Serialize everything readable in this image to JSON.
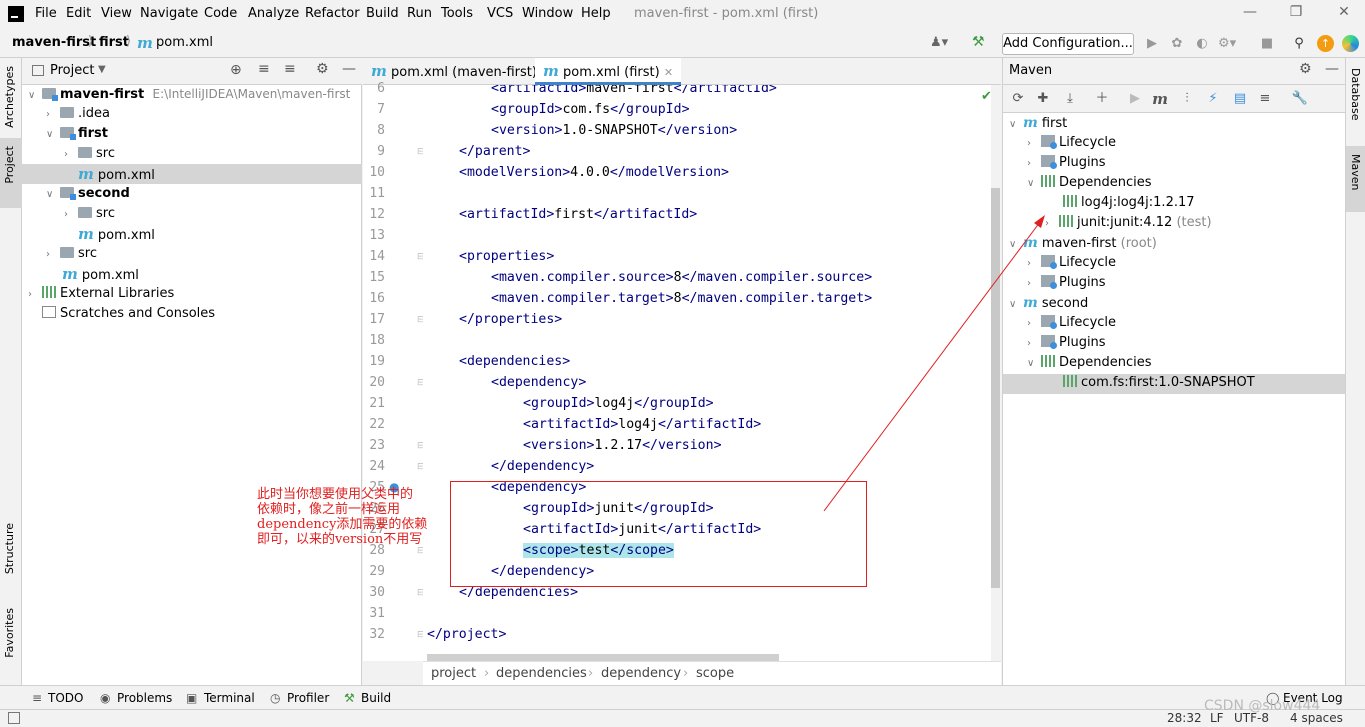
{
  "menubar": {
    "items": [
      "File",
      "Edit",
      "View",
      "Navigate",
      "Code",
      "Analyze",
      "Refactor",
      "Build",
      "Run",
      "Tools",
      "VCS",
      "Window",
      "Help"
    ],
    "title": "maven-first - pom.xml (first)"
  },
  "navbar": {
    "crumbs": [
      "maven-first",
      "first",
      "pom.xml"
    ],
    "add_config": "Add Configuration..."
  },
  "left_strip": {
    "archetypes": "Archetypes",
    "project": "Project",
    "structure": "Structure",
    "favorites": "Favorites"
  },
  "right_strip": {
    "database": "Database",
    "maven": "Maven"
  },
  "project_panel": {
    "title": "Project",
    "rows": [
      {
        "label": "maven-first",
        "extra": "E:\\IntelliJIDEA\\Maven\\maven-first"
      },
      {
        "label": ".idea"
      },
      {
        "label": "first"
      },
      {
        "label": "src"
      },
      {
        "label": "pom.xml"
      },
      {
        "label": "second"
      },
      {
        "label": "src"
      },
      {
        "label": "pom.xml"
      },
      {
        "label": "src"
      },
      {
        "label": "pom.xml"
      },
      {
        "label": "External Libraries"
      },
      {
        "label": "Scratches and Consoles"
      }
    ]
  },
  "editor": {
    "tabs": [
      "pom.xml (maven-first)",
      "pom.xml (first)"
    ],
    "line_numbers": [
      "6",
      "7",
      "8",
      "9",
      "10",
      "11",
      "12",
      "13",
      "14",
      "15",
      "16",
      "17",
      "18",
      "19",
      "20",
      "21",
      "22",
      "23",
      "24",
      "25",
      "26",
      "27",
      "28",
      "29",
      "30",
      "31",
      "32"
    ],
    "breadcrumb": [
      "project",
      "dependencies",
      "dependency",
      "scope"
    ]
  },
  "annotation": {
    "text_lines": [
      "此时当你想要使用父类中的",
      "依赖时，像之前一样运用",
      "dependency添加需要的依赖",
      "即可，以来的version不用写"
    ]
  },
  "maven_panel": {
    "title": "Maven",
    "rows": [
      {
        "label": "first"
      },
      {
        "label": "Lifecycle"
      },
      {
        "label": "Plugins"
      },
      {
        "label": "Dependencies"
      },
      {
        "label": "log4j:log4j:1.2.17"
      },
      {
        "label": "junit:junit:4.12",
        "extra": "(test)"
      },
      {
        "label": "maven-first",
        "extra": "(root)"
      },
      {
        "label": "Lifecycle"
      },
      {
        "label": "Plugins"
      },
      {
        "label": "second"
      },
      {
        "label": "Lifecycle"
      },
      {
        "label": "Plugins"
      },
      {
        "label": "Dependencies"
      },
      {
        "label": "com.fs:first:1.0-SNAPSHOT"
      }
    ]
  },
  "bottombar": [
    "TODO",
    "Problems",
    "Terminal",
    "Profiler",
    "Build"
  ],
  "event_log": "Event Log",
  "statusbar": {
    "position": "28:32",
    "line_sep": "LF",
    "encoding": "UTF-8",
    "indent": "4 spaces"
  },
  "watermark": "CSDN @slow444"
}
